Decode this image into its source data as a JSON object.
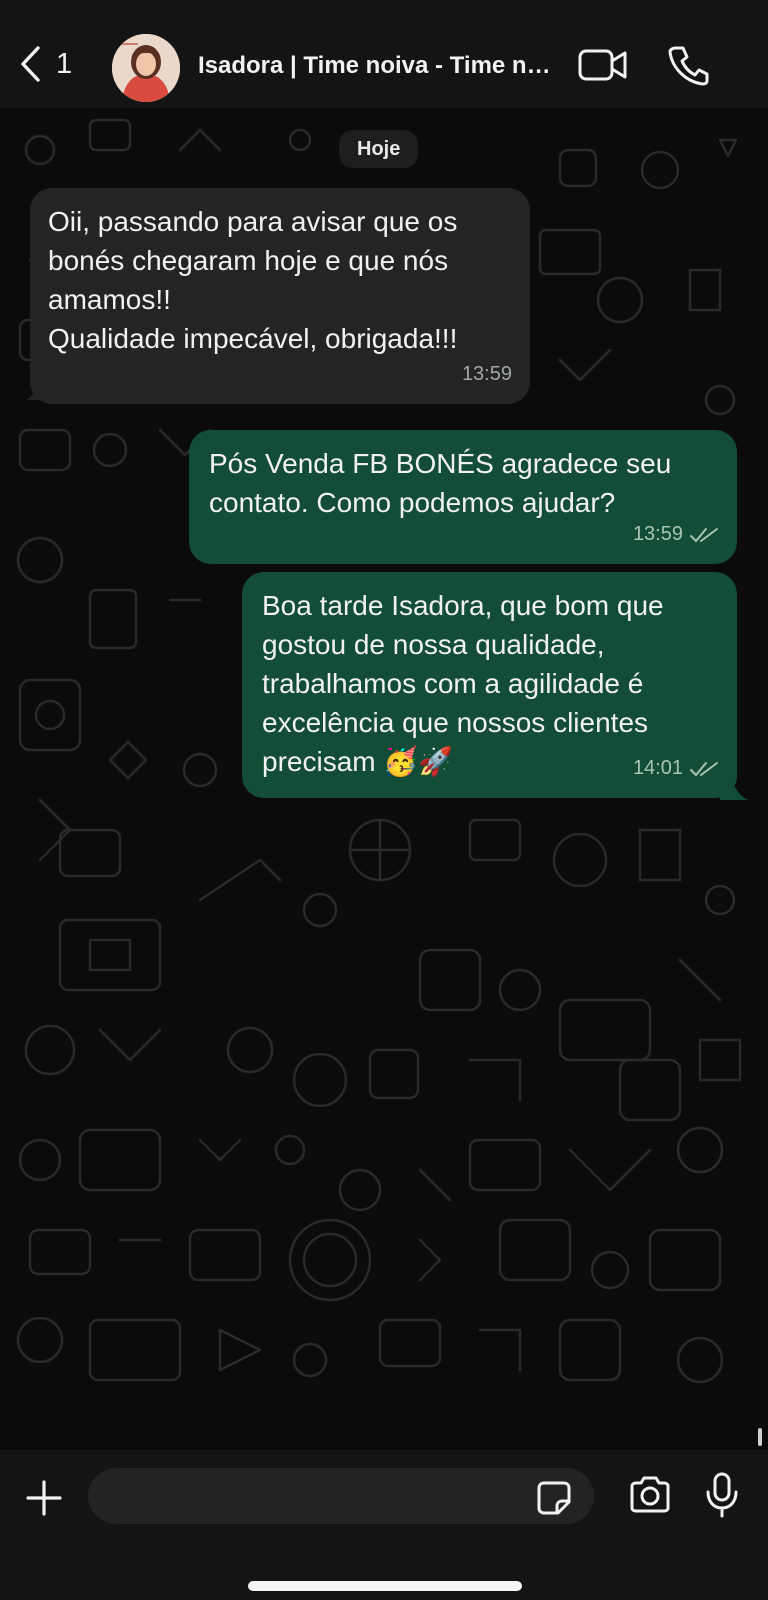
{
  "header": {
    "back_count": "1",
    "contact_name": "Isadora | Time noiva - Time noiva personalizados",
    "avatar_icon": "contact-avatar",
    "video_icon": "video-camera-icon",
    "call_icon": "phone-icon"
  },
  "date_chip": "Hoje",
  "messages": [
    {
      "direction": "incoming",
      "text": "Oii, passando para avisar que os\nbonés chegaram hoje e que nós\namamos!!\nQualidade impecável, obrigada!!!",
      "time": "13:59"
    },
    {
      "direction": "outgoing",
      "text": "Pós Venda FB BONÉS agradece seu\ncontato. Como podemos ajudar?",
      "time": "13:59",
      "status": "read"
    },
    {
      "direction": "outgoing",
      "text": "Boa tarde Isadora, que bom que\ngostou de nossa qualidade,\ntrabalhamos com a agilidade é\nexcelência que nossos clientes\nprecisam 🥳🚀",
      "time": "14:01",
      "status": "read"
    }
  ],
  "composer": {
    "placeholder": "",
    "plus_icon": "plus-icon",
    "sticker_icon": "sticker-icon",
    "camera_icon": "camera-icon",
    "mic_icon": "microphone-icon"
  },
  "colors": {
    "background": "#0b0b0b",
    "header": "#141414",
    "incoming_bubble": "#242424",
    "outgoing_bubble": "#134d37"
  }
}
